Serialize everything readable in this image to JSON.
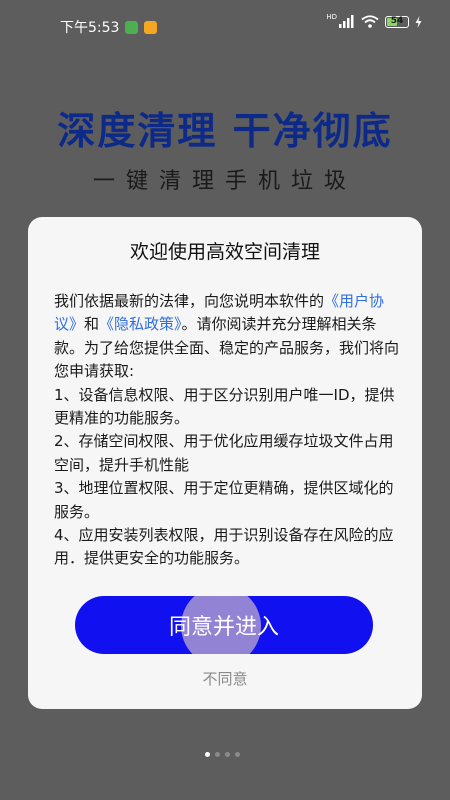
{
  "status_bar": {
    "time": "下午5:53",
    "hd_label": "HD",
    "battery_level": "54",
    "battery_fraction": 0.54
  },
  "headline": {
    "title": "深度清理 干净彻底",
    "subtitle": "一键清理手机垃圾"
  },
  "dialog": {
    "title": "欢迎使用高效空间清理",
    "intro_before": "我们依据最新的法律，向您说明本软件的",
    "user_agreement_link": "《用户协议》",
    "and_word": "和",
    "privacy_policy_link": "《隐私政策》",
    "intro_after": "。请你阅读并充分理解相关条款。为了给您提供全面、稳定的产品服务，我们将向您申请获取:",
    "permissions": [
      "1、设备信息权限、用于区分识别用户唯一ID，提供更精准的功能服务。",
      "2、存储空间权限、用于优化应用缓存垃圾文件占用空间，提升手机性能",
      "3、地理位置权限、用于定位更精确，提供区域化的服务。",
      "4、应用安装列表权限，用于识别设备存在风险的应用．提供更安全的功能服务。"
    ],
    "agree_label": "同意并进入",
    "disagree_label": "不同意"
  },
  "pager": {
    "page_count": 4,
    "active_index": 0
  },
  "colors": {
    "background": "#5d5d5d",
    "headline": "#0e2a88",
    "link": "#2f6fde",
    "agree_button": "#1010f0",
    "dialog_bg": "#f6f6f6"
  }
}
